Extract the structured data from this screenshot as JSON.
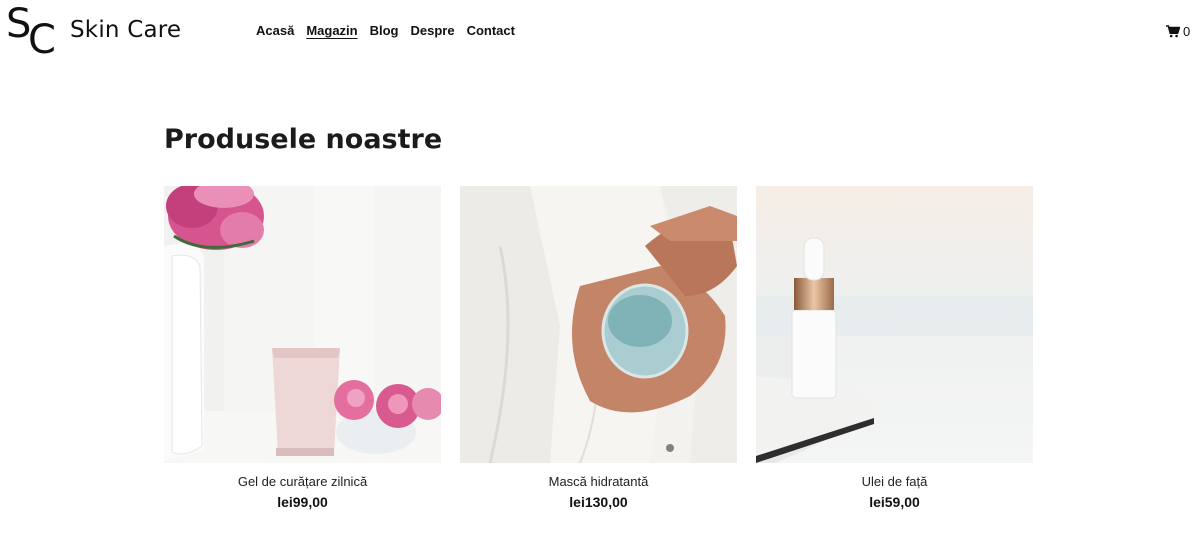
{
  "header": {
    "logo_s": "S",
    "logo_c": "C",
    "brand": "Skin Care",
    "nav": [
      {
        "label": "Acasă"
      },
      {
        "label": "Magazin"
      },
      {
        "label": "Blog"
      },
      {
        "label": "Despre"
      },
      {
        "label": "Contact"
      }
    ],
    "active_nav": "Magazin",
    "cart": {
      "icon": "cart-icon",
      "count": "0"
    }
  },
  "main": {
    "title": "Produsele noastre",
    "products": [
      {
        "name": "Gel de curățare zilnică",
        "price": "lei99,00",
        "image": "cleansing-gel-tube-with-pink-flowers"
      },
      {
        "name": "Mască hidratantă",
        "price": "lei130,00",
        "image": "hands-holding-open-jar-of-blue-gel"
      },
      {
        "name": "Ulei de față",
        "price": "lei59,00",
        "image": "dropper-bottle-on-marble-tray"
      }
    ]
  },
  "colors": {
    "text": "#111111",
    "background": "#ffffff"
  }
}
